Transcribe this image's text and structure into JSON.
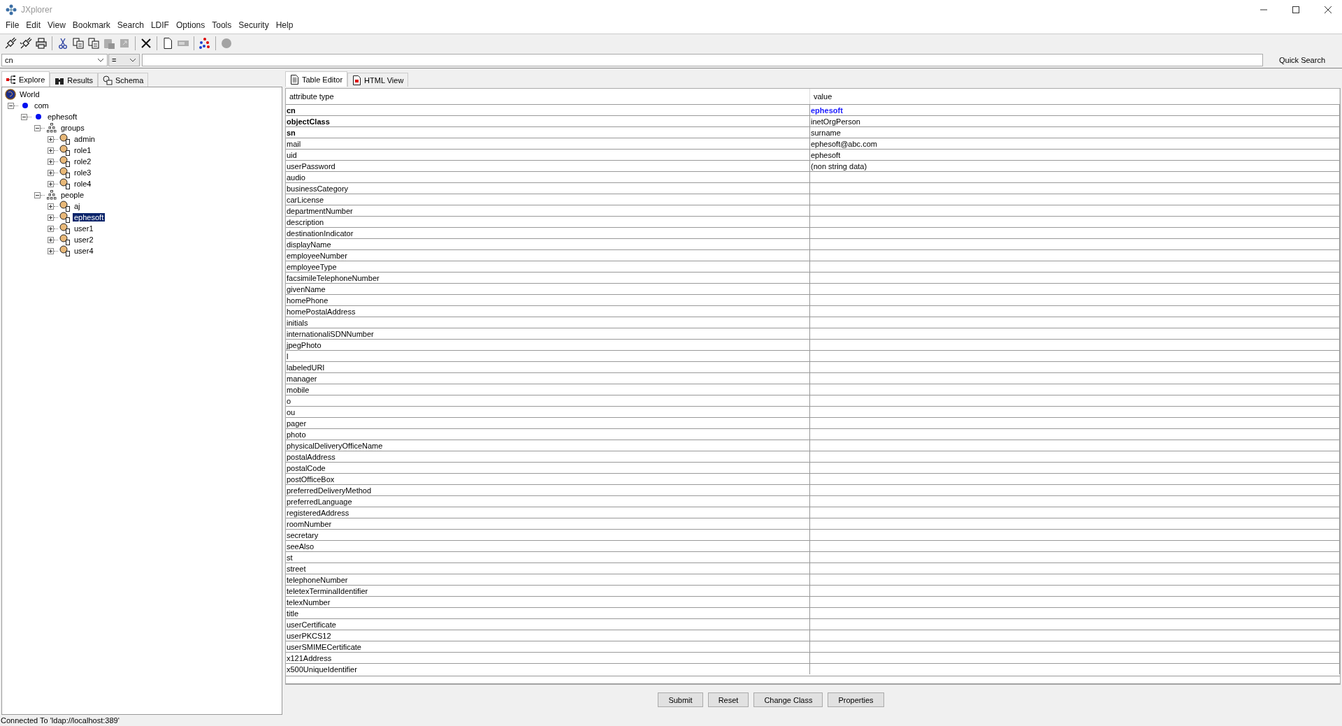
{
  "window": {
    "title": "JXplorer"
  },
  "menu": [
    "File",
    "Edit",
    "View",
    "Bookmark",
    "Search",
    "LDIF",
    "Options",
    "Tools",
    "Security",
    "Help"
  ],
  "toolbar_groups": [
    [
      {
        "kind": "connect",
        "disabled": false
      },
      {
        "kind": "disconnect",
        "disabled": false
      },
      {
        "kind": "print",
        "disabled": false
      }
    ],
    [
      {
        "kind": "cut",
        "disabled": false
      },
      {
        "kind": "copy",
        "disabled": false
      },
      {
        "kind": "copy-dn",
        "disabled": false
      },
      {
        "kind": "paste",
        "disabled": true
      },
      {
        "kind": "paste-alias",
        "disabled": true
      }
    ],
    [
      {
        "kind": "delete",
        "disabled": false
      }
    ],
    [
      {
        "kind": "new",
        "disabled": false
      },
      {
        "kind": "rename",
        "disabled": true
      }
    ],
    [
      {
        "kind": "refresh",
        "disabled": false
      }
    ],
    [
      {
        "kind": "stop",
        "disabled": true
      }
    ]
  ],
  "quick_search": {
    "attribute": "cn",
    "operator": "=",
    "button": "Quick Search"
  },
  "left_tabs": [
    {
      "label": "Explore",
      "kind": "explore",
      "selected": true
    },
    {
      "label": "Results",
      "kind": "results",
      "selected": false
    },
    {
      "label": "Schema",
      "kind": "schema",
      "selected": false
    }
  ],
  "tree": {
    "label": "World",
    "kind": "world",
    "selected": false,
    "children": [
      {
        "label": "com",
        "kind": "domain",
        "expanded": true,
        "selected": false,
        "children": [
          {
            "label": "ephesoft",
            "kind": "domain",
            "expanded": true,
            "selected": false,
            "children": [
              {
                "label": "groups",
                "kind": "org-unit",
                "expanded": true,
                "selected": false,
                "children": [
                  {
                    "label": "admin",
                    "kind": "entry",
                    "expanded": false,
                    "selected": false
                  },
                  {
                    "label": "role1",
                    "kind": "entry",
                    "expanded": false,
                    "selected": false
                  },
                  {
                    "label": "role2",
                    "kind": "entry",
                    "expanded": false,
                    "selected": false
                  },
                  {
                    "label": "role3",
                    "kind": "entry",
                    "expanded": false,
                    "selected": false
                  },
                  {
                    "label": "role4",
                    "kind": "entry",
                    "expanded": false,
                    "selected": false
                  }
                ]
              },
              {
                "label": "people",
                "kind": "org-unit",
                "expanded": true,
                "selected": false,
                "children": [
                  {
                    "label": "aj",
                    "kind": "entry",
                    "expanded": false,
                    "selected": false
                  },
                  {
                    "label": "ephesoft",
                    "kind": "entry",
                    "expanded": false,
                    "selected": true
                  },
                  {
                    "label": "user1",
                    "kind": "entry",
                    "expanded": false,
                    "selected": false
                  },
                  {
                    "label": "user2",
                    "kind": "entry",
                    "expanded": false,
                    "selected": false
                  },
                  {
                    "label": "user4",
                    "kind": "entry",
                    "expanded": false,
                    "selected": false
                  }
                ]
              }
            ]
          }
        ]
      }
    ]
  },
  "right_tabs": [
    {
      "label": "Table Editor",
      "kind": "table",
      "selected": true
    },
    {
      "label": "HTML View",
      "kind": "html",
      "selected": false
    }
  ],
  "table": {
    "columns": [
      "attribute type",
      "value"
    ],
    "rows": [
      {
        "attribute": "cn",
        "value": "ephesoft",
        "required": true,
        "naming": true
      },
      {
        "attribute": "objectClass",
        "value": "inetOrgPerson",
        "required": true,
        "naming": false
      },
      {
        "attribute": "sn",
        "value": "surname",
        "required": true,
        "naming": false
      },
      {
        "attribute": "mail",
        "value": "ephesoft@abc.com",
        "required": false,
        "naming": false
      },
      {
        "attribute": "uid",
        "value": "ephesoft",
        "required": false,
        "naming": false
      },
      {
        "attribute": "userPassword",
        "value": "(non string data)",
        "required": false,
        "naming": false
      },
      {
        "attribute": "audio",
        "required": false
      },
      {
        "attribute": "businessCategory",
        "required": false
      },
      {
        "attribute": "carLicense",
        "required": false
      },
      {
        "attribute": "departmentNumber",
        "required": false
      },
      {
        "attribute": "description",
        "required": false
      },
      {
        "attribute": "destinationIndicator",
        "required": false
      },
      {
        "attribute": "displayName",
        "required": false
      },
      {
        "attribute": "employeeNumber",
        "required": false
      },
      {
        "attribute": "employeeType",
        "required": false
      },
      {
        "attribute": "facsimileTelephoneNumber",
        "required": false
      },
      {
        "attribute": "givenName",
        "required": false
      },
      {
        "attribute": "homePhone",
        "required": false
      },
      {
        "attribute": "homePostalAddress",
        "required": false
      },
      {
        "attribute": "initials",
        "required": false
      },
      {
        "attribute": "internationaliSDNNumber",
        "required": false
      },
      {
        "attribute": "jpegPhoto",
        "required": false
      },
      {
        "attribute": "l",
        "required": false
      },
      {
        "attribute": "labeledURI",
        "required": false
      },
      {
        "attribute": "manager",
        "required": false
      },
      {
        "attribute": "mobile",
        "required": false
      },
      {
        "attribute": "o",
        "required": false
      },
      {
        "attribute": "ou",
        "required": false
      },
      {
        "attribute": "pager",
        "required": false
      },
      {
        "attribute": "photo",
        "required": false
      },
      {
        "attribute": "physicalDeliveryOfficeName",
        "required": false
      },
      {
        "attribute": "postalAddress",
        "required": false
      },
      {
        "attribute": "postalCode",
        "required": false
      },
      {
        "attribute": "postOfficeBox",
        "required": false
      },
      {
        "attribute": "preferredDeliveryMethod",
        "required": false
      },
      {
        "attribute": "preferredLanguage",
        "required": false
      },
      {
        "attribute": "registeredAddress",
        "required": false
      },
      {
        "attribute": "roomNumber",
        "required": false
      },
      {
        "attribute": "secretary",
        "required": false
      },
      {
        "attribute": "seeAlso",
        "required": false
      },
      {
        "attribute": "st",
        "required": false
      },
      {
        "attribute": "street",
        "required": false
      },
      {
        "attribute": "telephoneNumber",
        "required": false
      },
      {
        "attribute": "teletexTerminalIdentifier",
        "required": false
      },
      {
        "attribute": "telexNumber",
        "required": false
      },
      {
        "attribute": "title",
        "required": false
      },
      {
        "attribute": "userCertificate",
        "required": false
      },
      {
        "attribute": "userPKCS12",
        "required": false
      },
      {
        "attribute": "userSMIMECertificate",
        "required": false
      },
      {
        "attribute": "x121Address",
        "required": false
      },
      {
        "attribute": "x500UniqueIdentifier",
        "required": false
      }
    ]
  },
  "buttons": [
    "Submit",
    "Reset",
    "Change Class",
    "Properties"
  ],
  "status_bar": "Connected To 'ldap://localhost:389'"
}
